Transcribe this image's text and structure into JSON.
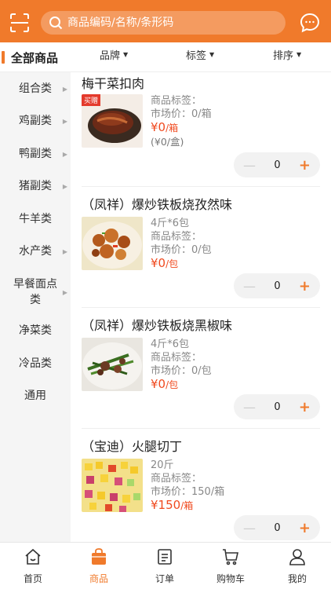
{
  "header": {
    "search_placeholder": "商品编码/名称/条形码"
  },
  "filterbar": {
    "all_label": "全部商品",
    "filters": [
      "品牌",
      "标签",
      "排序"
    ]
  },
  "sidebar": {
    "items": [
      {
        "label": "组合类",
        "arrow": true
      },
      {
        "label": "鸡副类",
        "arrow": true
      },
      {
        "label": "鸭副类",
        "arrow": true
      },
      {
        "label": "猪副类",
        "arrow": true
      },
      {
        "label": "牛羊类",
        "arrow": false
      },
      {
        "label": "水产类",
        "arrow": true
      },
      {
        "label": "早餐面点类",
        "arrow": true
      },
      {
        "label": "净菜类",
        "arrow": false
      },
      {
        "label": "冷品类",
        "arrow": false
      },
      {
        "label": "通用",
        "arrow": false
      }
    ]
  },
  "products": [
    {
      "name": "梅干菜扣肉",
      "badge": "买赠",
      "spec": "",
      "tag_label": "商品标签：",
      "market_label": "市场价：",
      "market_value": "0/箱",
      "price": "¥0",
      "price_unit": "/箱",
      "sub_price": "(¥0/盒)",
      "qty": "0"
    },
    {
      "name": "（凤祥）爆炒铁板烧孜然味",
      "badge": "",
      "spec": "4斤*6包",
      "tag_label": "商品标签：",
      "market_label": "市场价：",
      "market_value": "0/包",
      "price": "¥0",
      "price_unit": "/包",
      "sub_price": "",
      "qty": "0"
    },
    {
      "name": "（凤祥）爆炒铁板烧黑椒味",
      "badge": "",
      "spec": "4斤*6包",
      "tag_label": "商品标签：",
      "market_label": "市场价：",
      "market_value": "0/包",
      "price": "¥0",
      "price_unit": "/包",
      "sub_price": "",
      "qty": "0"
    },
    {
      "name": "（宝迪）火腿切丁",
      "badge": "",
      "spec": "20斤",
      "tag_label": "商品标签：",
      "market_label": "市场价：",
      "market_value": "150/箱",
      "price": "¥150",
      "price_unit": "/箱",
      "sub_price": "",
      "qty": "0"
    }
  ],
  "tabbar": {
    "tabs": [
      {
        "label": "首页",
        "icon": "home-icon",
        "active": false
      },
      {
        "label": "商品",
        "icon": "bag-icon",
        "active": true
      },
      {
        "label": "订单",
        "icon": "order-icon",
        "active": false
      },
      {
        "label": "购物车",
        "icon": "cart-icon",
        "active": false
      },
      {
        "label": "我的",
        "icon": "user-icon",
        "active": false
      }
    ]
  },
  "colors": {
    "accent": "#f07a2b",
    "price": "#f04a1f",
    "badge": "#e43a2c"
  }
}
